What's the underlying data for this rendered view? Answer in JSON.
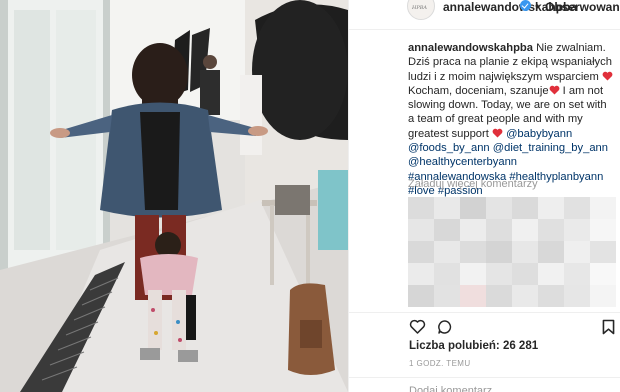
{
  "post": {
    "photo_alt": "photo",
    "header": {
      "username": "annalewandowskahpba",
      "follow_label": "Obserwowanie",
      "avatar_icon": "profile-avatar"
    },
    "caption": {
      "username": "annalewandowskahpba",
      "text_pl": "Nie zwalniam. Dziś praca na planie z ekipą wspaniałych ludzi i z moim największym wsparciem",
      "text_pl2": "Kocham, doceniam, szanuje",
      "text_en": "I am not slowing down. Today, we are on set with a team of great people and with my greatest support",
      "mentions": [
        "@babybyann",
        "@foods_by_ann",
        "@diet_training_by_ann",
        "@healthycenterbyann"
      ],
      "hashtags": [
        "#annalewandowska",
        "#healthyplanbyann",
        "#love",
        "#passion"
      ]
    },
    "load_more_label": "Załaduj więcej komentarzy",
    "icons": {
      "like": "heart-icon",
      "comment": "comment-icon",
      "save": "bookmark-icon"
    },
    "likes_label": "Liczba polubień:",
    "likes_count": "26 281",
    "time_label": "1 GODZ. TEMU",
    "add_comment_placeholder": "Dodaj komentarz..."
  },
  "colors": {
    "accent_blue": "#3897f0",
    "hashtag_blue": "#003569",
    "heart_red": "#ed4956",
    "muted_gray": "#999999"
  }
}
